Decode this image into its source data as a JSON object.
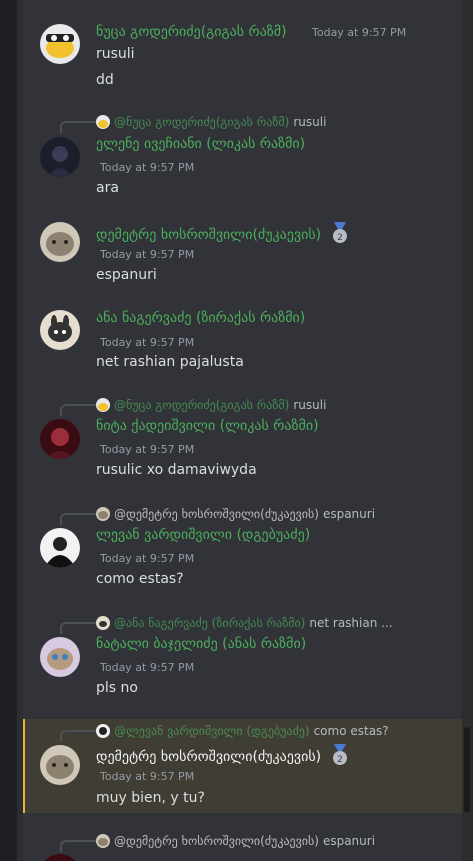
{
  "messages": [
    {
      "author": "ნუცა გოდერიძე(გიგას რაზმ)",
      "time": "Today at 9:57 PM",
      "lines": [
        "rusuli",
        "dd"
      ]
    },
    {
      "reply": {
        "author": "@ნუცა გოდერიძე(გიგას რაზმ)",
        "text": "rusuli"
      },
      "author": "ელენე ივეჩიანი (ლიკას რაზმი)",
      "time": "Today at 9:57 PM",
      "lines": [
        "ara"
      ]
    },
    {
      "author": "დემეტრე ხოსროშვილი(ძუკაევის)",
      "time": "Today at 9:57 PM",
      "lines": [
        "espanuri"
      ],
      "badge": "2"
    },
    {
      "author": "ანა ნაგერვაძე (ზირაქას რაზმი)",
      "time": "Today at 9:57 PM",
      "lines": [
        "net rashian pajalusta"
      ]
    },
    {
      "reply": {
        "author": "@ნუცა გოდერიძე(გიგას რაზმ)",
        "text": "rusuli"
      },
      "author": "ნიტა ქადეიშვილი (ლიკას რაზმი)",
      "time": "Today at 9:57 PM",
      "lines": [
        "rusulic xo damaviwyda"
      ]
    },
    {
      "reply": {
        "author": "@დემეტრე ხოსროშვილი(ძუკაევის)",
        "text": "espanuri"
      },
      "author": "ლევან ვარდიშვილი (დგებუაძე)",
      "time": "Today at 9:57 PM",
      "lines": [
        "como estas?"
      ]
    },
    {
      "reply": {
        "author": "@ანა ნაგერვაძე (ზირაქას რაზმი)",
        "text": "net rashian ..."
      },
      "author": "ნატალი ბაჯელიძე (ანას რაზმი)",
      "time": "Today at 9:57 PM",
      "lines": [
        "pls no"
      ]
    },
    {
      "reply": {
        "author": "@ლევან ვარდიშვილი (დგებუაძე)",
        "text": "como estas?"
      },
      "author": "დემეტრე ხოსროშვილი(ძუკაევის)",
      "time": "Today at 9:57 PM",
      "lines": [
        "muy bien, y tu?"
      ],
      "badge": "2"
    },
    {
      "reply": {
        "author": "@დემეტრე ხოსროშვილი(ძუკაევის)",
        "text": "espanuri"
      }
    }
  ],
  "colors": {
    "background": "#313338",
    "username_green": "#4caf5c",
    "highlight": "#403d34",
    "highlight_bar": "#f0b232"
  }
}
